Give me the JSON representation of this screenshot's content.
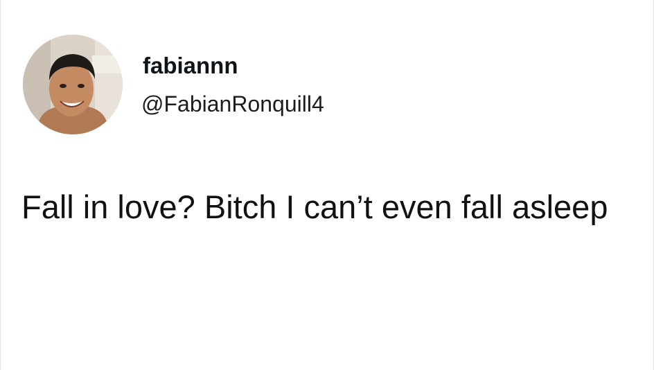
{
  "tweet": {
    "author": {
      "display_name": "fabiannn",
      "handle": "@FabianRonquill4"
    },
    "text": "Fall in love? Bitch I can’t even fall asleep"
  }
}
